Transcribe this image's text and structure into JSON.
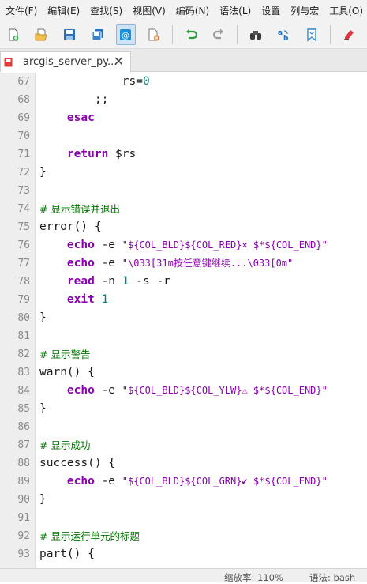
{
  "menu": [
    "文件(F)",
    "编辑(E)",
    "查找(S)",
    "视图(V)",
    "编码(N)",
    "语法(L)",
    "设置",
    "列与宏",
    "工具(O)"
  ],
  "toolbar": {
    "icons": [
      "new-file-icon",
      "open-file-icon",
      "save-icon",
      "save-all-icon",
      "at-sign-icon",
      "close-file-icon",
      "undo-icon",
      "redo-icon",
      "binoculars-icon",
      "find-replace-icon",
      "bookmark-icon",
      "highlighter-icon"
    ],
    "active": "at-sign-icon"
  },
  "tab": {
    "name": "arcgis_server_py...",
    "close": "✕"
  },
  "lines": [
    {
      "n": "67",
      "tokens": [
        [
          "plain",
          "            rs="
        ],
        [
          "num",
          "0"
        ]
      ]
    },
    {
      "n": "68",
      "tokens": [
        [
          "plain",
          "        ;;"
        ]
      ]
    },
    {
      "n": "69",
      "tokens": [
        [
          "plain",
          "    "
        ],
        [
          "kw",
          "esac"
        ]
      ]
    },
    {
      "n": "70",
      "tokens": []
    },
    {
      "n": "71",
      "tokens": [
        [
          "plain",
          "    "
        ],
        [
          "kw",
          "return"
        ],
        [
          "plain",
          " $rs"
        ]
      ]
    },
    {
      "n": "72",
      "tokens": [
        [
          "plain",
          "}"
        ]
      ]
    },
    {
      "n": "73",
      "tokens": []
    },
    {
      "n": "74",
      "tokens": [
        [
          "cmt",
          "# 显示错误并退出"
        ]
      ]
    },
    {
      "n": "75",
      "tokens": [
        [
          "plain",
          "error() {"
        ]
      ]
    },
    {
      "n": "76",
      "tokens": [
        [
          "plain",
          "    "
        ],
        [
          "kw",
          "echo"
        ],
        [
          "plain",
          " -e "
        ],
        [
          "str",
          "\"${COL_BLD}${COL_RED}× $*${COL_END}\""
        ]
      ]
    },
    {
      "n": "77",
      "tokens": [
        [
          "plain",
          "    "
        ],
        [
          "kw",
          "echo"
        ],
        [
          "plain",
          " -e "
        ],
        [
          "str",
          "\"\\033[31m按任意键继续...\\033[0m\""
        ]
      ]
    },
    {
      "n": "78",
      "tokens": [
        [
          "plain",
          "    "
        ],
        [
          "kw",
          "read"
        ],
        [
          "plain",
          " -n "
        ],
        [
          "num",
          "1"
        ],
        [
          "plain",
          " -s -r"
        ]
      ]
    },
    {
      "n": "79",
      "tokens": [
        [
          "plain",
          "    "
        ],
        [
          "kw",
          "exit"
        ],
        [
          "plain",
          " "
        ],
        [
          "num",
          "1"
        ]
      ]
    },
    {
      "n": "80",
      "tokens": [
        [
          "plain",
          "}"
        ]
      ]
    },
    {
      "n": "81",
      "tokens": []
    },
    {
      "n": "82",
      "tokens": [
        [
          "cmt",
          "# 显示警告"
        ]
      ]
    },
    {
      "n": "83",
      "tokens": [
        [
          "plain",
          "warn() {"
        ]
      ]
    },
    {
      "n": "84",
      "tokens": [
        [
          "plain",
          "    "
        ],
        [
          "kw",
          "echo"
        ],
        [
          "plain",
          " -e "
        ],
        [
          "str",
          "\"${COL_BLD}${COL_YLW}⚠ $*${COL_END}\""
        ]
      ]
    },
    {
      "n": "85",
      "tokens": [
        [
          "plain",
          "}"
        ]
      ]
    },
    {
      "n": "86",
      "tokens": []
    },
    {
      "n": "87",
      "tokens": [
        [
          "cmt",
          "# 显示成功"
        ]
      ]
    },
    {
      "n": "88",
      "tokens": [
        [
          "plain",
          "success() {"
        ]
      ]
    },
    {
      "n": "89",
      "tokens": [
        [
          "plain",
          "    "
        ],
        [
          "kw",
          "echo"
        ],
        [
          "plain",
          " -e "
        ],
        [
          "str",
          "\"${COL_BLD}${COL_GRN}✔ $*${COL_END}\""
        ]
      ]
    },
    {
      "n": "90",
      "tokens": [
        [
          "plain",
          "}"
        ]
      ]
    },
    {
      "n": "91",
      "tokens": []
    },
    {
      "n": "92",
      "tokens": [
        [
          "cmt",
          "# 显示运行单元的标题"
        ]
      ]
    },
    {
      "n": "93",
      "tokens": [
        [
          "plain",
          "part() {"
        ]
      ]
    }
  ],
  "status": {
    "zoom": "缩放率: 110%",
    "language": "语法: bash"
  },
  "colors": {
    "keyword": "#8b00b0",
    "string": "#8b00b0",
    "number": "#008080",
    "comment": "#007400"
  }
}
